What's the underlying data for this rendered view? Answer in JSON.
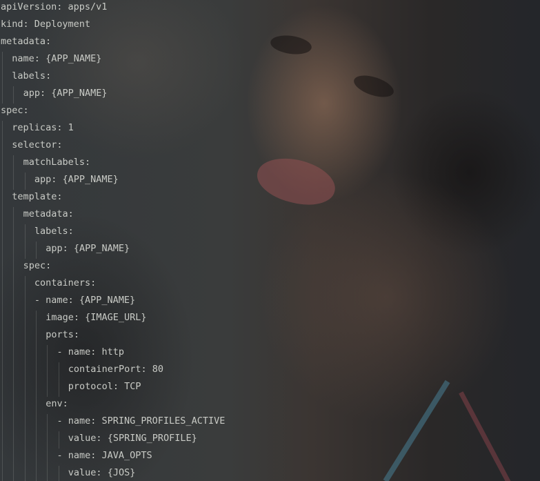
{
  "editor": {
    "lines": [
      {
        "indent": 0,
        "text": "apiVersion: apps/v1"
      },
      {
        "indent": 0,
        "text": "kind: Deployment"
      },
      {
        "indent": 0,
        "text": "metadata:"
      },
      {
        "indent": 1,
        "text": "name: {APP_NAME}"
      },
      {
        "indent": 1,
        "text": "labels:"
      },
      {
        "indent": 2,
        "text": "app: {APP_NAME}"
      },
      {
        "indent": 0,
        "text": "spec:"
      },
      {
        "indent": 1,
        "text": "replicas: 1"
      },
      {
        "indent": 1,
        "text": "selector:"
      },
      {
        "indent": 2,
        "text": "matchLabels:"
      },
      {
        "indent": 3,
        "text": "app: {APP_NAME}"
      },
      {
        "indent": 1,
        "text": "template:"
      },
      {
        "indent": 2,
        "text": "metadata:"
      },
      {
        "indent": 3,
        "text": "labels:"
      },
      {
        "indent": 4,
        "text": "app: {APP_NAME}"
      },
      {
        "indent": 2,
        "text": "spec:"
      },
      {
        "indent": 3,
        "text": "containers:"
      },
      {
        "indent": 3,
        "text": "- name: {APP_NAME}"
      },
      {
        "indent": 4,
        "text": "image: {IMAGE_URL}"
      },
      {
        "indent": 4,
        "text": "ports:"
      },
      {
        "indent": 5,
        "text": "- name: http"
      },
      {
        "indent": 6,
        "text": "containerPort: 80"
      },
      {
        "indent": 6,
        "text": "protocol: TCP"
      },
      {
        "indent": 4,
        "text": "env:"
      },
      {
        "indent": 5,
        "text": "- name: SPRING_PROFILES_ACTIVE"
      },
      {
        "indent": 6,
        "text": "value: {SPRING_PROFILE}"
      },
      {
        "indent": 5,
        "text": "- name: JAVA_OPTS"
      },
      {
        "indent": 6,
        "text": "value: {JOS}"
      }
    ]
  }
}
